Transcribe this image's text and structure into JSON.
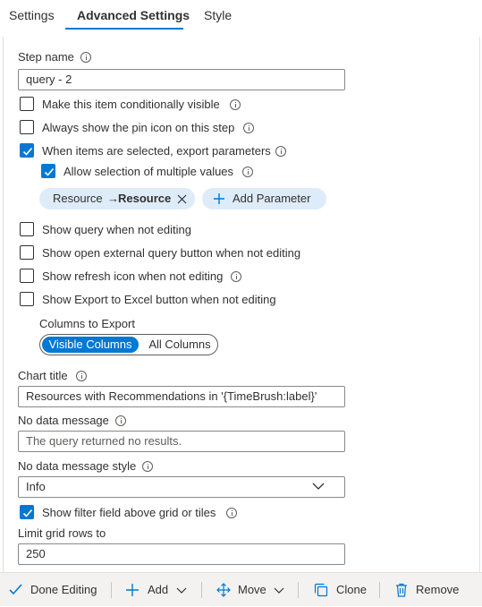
{
  "tabs": [
    "Settings",
    "Advanced Settings",
    "Style"
  ],
  "step_name": {
    "label": "Step name",
    "value": "query - 2"
  },
  "checkboxes": {
    "conditionally_visible": {
      "label": "Make this item conditionally visible",
      "checked": false
    },
    "always_pin": {
      "label": "Always show the pin icon on this step",
      "checked": false
    },
    "export_params": {
      "label": "When items are selected, export parameters",
      "checked": true
    },
    "allow_multiple": {
      "label": "Allow selection of multiple values",
      "checked": true
    },
    "show_query": {
      "label": "Show query when not editing",
      "checked": false
    },
    "show_external": {
      "label": "Show open external query button when not editing",
      "checked": false
    },
    "show_refresh": {
      "label": "Show refresh icon when not editing",
      "checked": false
    },
    "show_export": {
      "label": "Show Export to Excel button when not editing",
      "checked": false
    },
    "show_filter": {
      "label": "Show filter field above grid or tiles",
      "checked": true
    }
  },
  "parameter_pill": {
    "from": "Resource",
    "arrow": "→",
    "to": "Resource"
  },
  "add_parameter_label": "Add Parameter",
  "columns_to_export": {
    "label": "Columns to Export",
    "options": [
      "Visible Columns",
      "All Columns"
    ],
    "selected": "Visible Columns"
  },
  "chart_title": {
    "label": "Chart title",
    "value": "Resources with Recommendations in '{TimeBrush:label}'"
  },
  "no_data_message": {
    "label": "No data message",
    "placeholder": "The query returned no results."
  },
  "no_data_style": {
    "label": "No data message style",
    "value": "Info"
  },
  "limit_rows": {
    "label": "Limit grid rows to",
    "value": "250"
  },
  "toolbar": {
    "done": "Done Editing",
    "add": "Add",
    "move": "Move",
    "clone": "Clone",
    "remove": "Remove"
  },
  "colors": {
    "accent": "#0078d4",
    "pill_bg": "#deecf9",
    "toolbar_bg": "#f3f2f1"
  }
}
